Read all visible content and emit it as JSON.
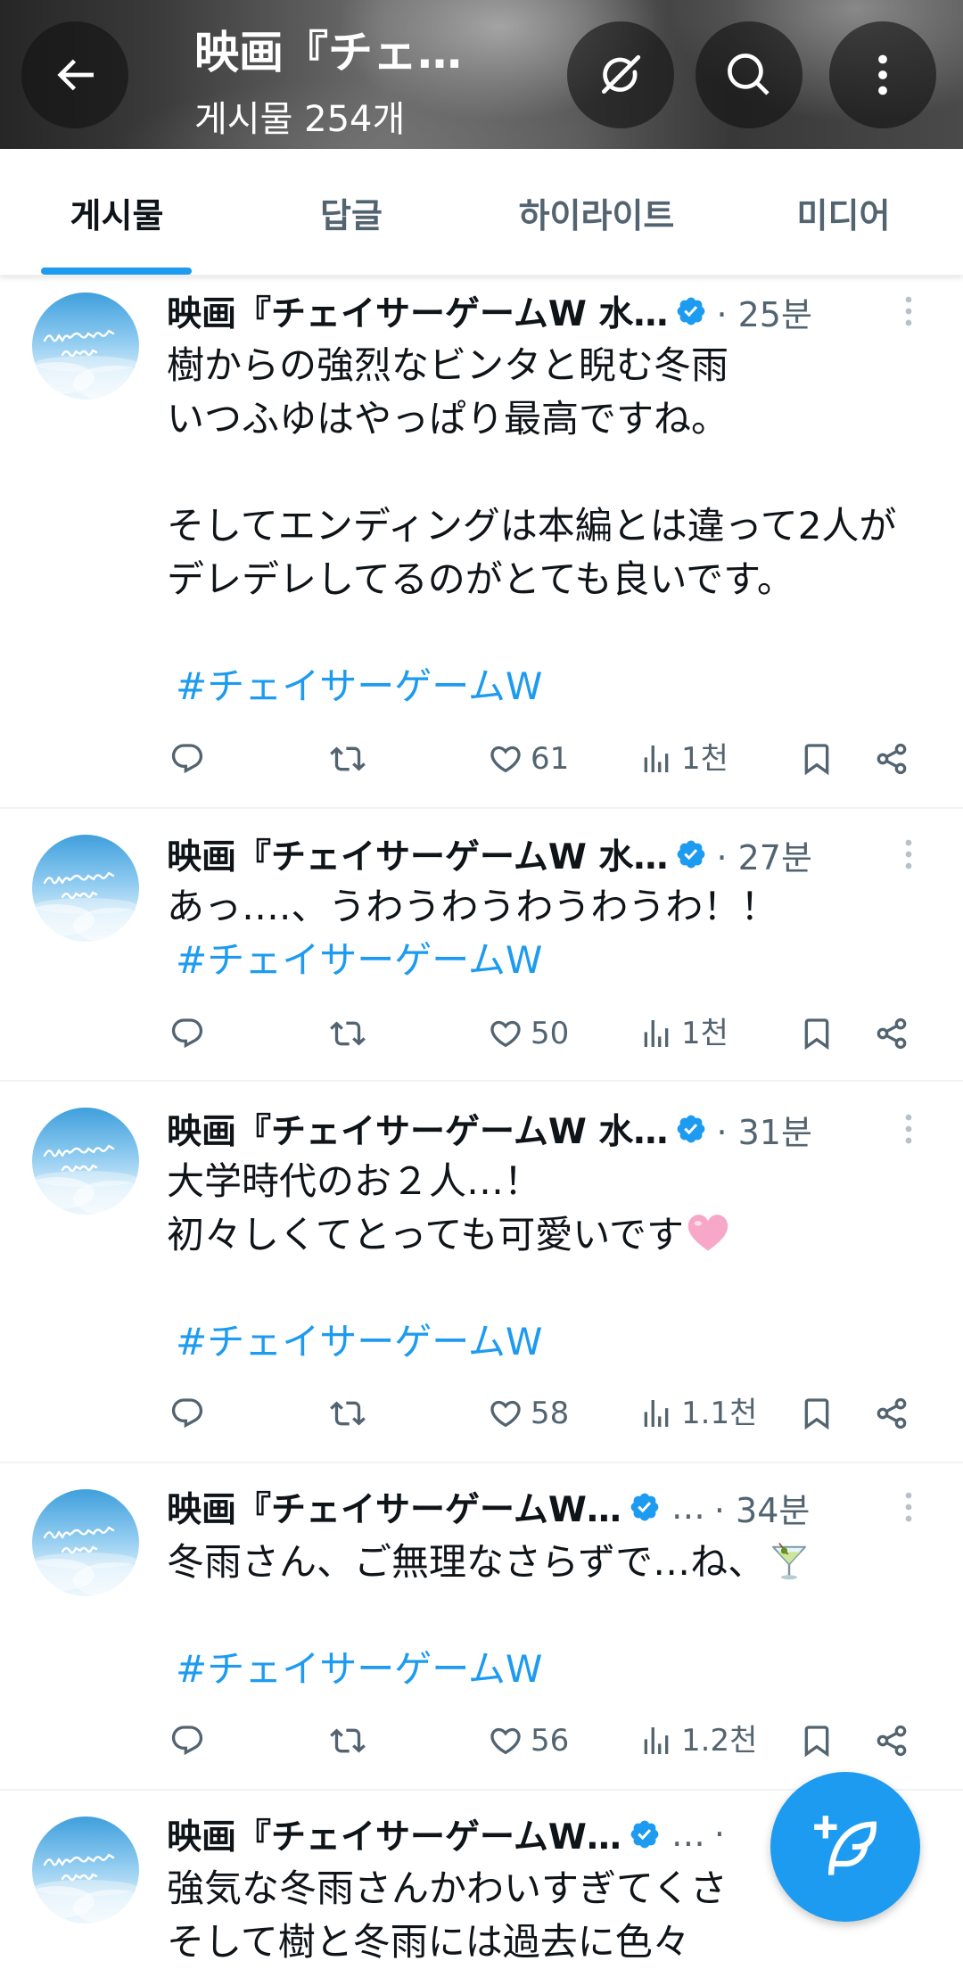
{
  "header": {
    "title": "映画『チェ…",
    "subtitle": "게시물 254개",
    "back_icon": "arrow-left-icon",
    "grok_icon": "grok-icon",
    "search_icon": "search-icon",
    "more_icon": "more-vertical-icon"
  },
  "tabs": [
    {
      "label": "게시물",
      "active": true
    },
    {
      "label": "답글",
      "active": false
    },
    {
      "label": "하이라이트",
      "active": false
    },
    {
      "label": "미디어",
      "active": false
    }
  ],
  "colors": {
    "accent": "#1d9bf0",
    "text": "#0f1419",
    "muted": "#536471",
    "divider": "#eff3f4"
  },
  "posts": [
    {
      "name": "映画『チェイサーゲームW 水…",
      "verified": true,
      "meta": "· 25분",
      "lines": [
        "樹からの強烈なビンタと睨む冬雨",
        "いつふゆはやっぱり最高ですね。",
        "そしてエンディングは本編とは違って2人が",
        "デレデレしてるのがとても良いです。"
      ],
      "hashtag": "#チェイサーゲームW",
      "stats": {
        "likes": "61",
        "views": "1천"
      }
    },
    {
      "name": "映画『チェイサーゲームW 水…",
      "verified": true,
      "meta": "· 27분",
      "lines": [
        "あっ….、うわうわうわうわうわ！！"
      ],
      "hashtag": "#チェイサーゲームW",
      "stats": {
        "likes": "50",
        "views": "1천"
      }
    },
    {
      "name": "映画『チェイサーゲームW 水…",
      "verified": true,
      "meta": "· 31분",
      "lines": [
        "大学時代のお２人…！",
        "初々しくてとっても可愛いです"
      ],
      "emoji": "pink-heart",
      "hashtag": "#チェイサーゲームW",
      "stats": {
        "likes": "58",
        "views": "1.1천"
      }
    },
    {
      "name": "映画『チェイサーゲームW…",
      "verified": true,
      "handle": "…",
      "meta": "· 34분",
      "lines": [
        "冬雨さん、ご無理なさらずで…ね、"
      ],
      "emoji": "cocktail-glass",
      "hashtag": "#チェイサーゲームW",
      "stats": {
        "likes": "56",
        "views": "1.2천"
      }
    },
    {
      "name": "映画『チェイサーゲームW…",
      "verified": true,
      "handle": "…",
      "meta": "·",
      "lines": [
        "強気な冬雨さんかわいすぎてくさ",
        "そして樹と冬雨には過去に色々"
      ]
    }
  ],
  "fab": {
    "icon": "compose-post-icon"
  }
}
